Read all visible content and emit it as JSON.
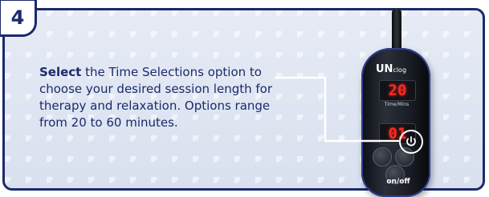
{
  "step": {
    "number": "4"
  },
  "instruction": {
    "bold_lead": "Select",
    "text": " the Time Selections option to choose your desired session length for therapy and relaxation. Options range from 20 to 60 minutes."
  },
  "device": {
    "brand": "UN",
    "brand_suffix": "clog",
    "display_top": "20",
    "display_label": "Time/Mins",
    "display_bottom": "01",
    "power_label": "on/off"
  },
  "colors": {
    "navy": "#1b2a6b",
    "led_red": "#ff2a1f",
    "background": "#dfe5f2"
  },
  "icons": {
    "time_button": "power-icon"
  }
}
